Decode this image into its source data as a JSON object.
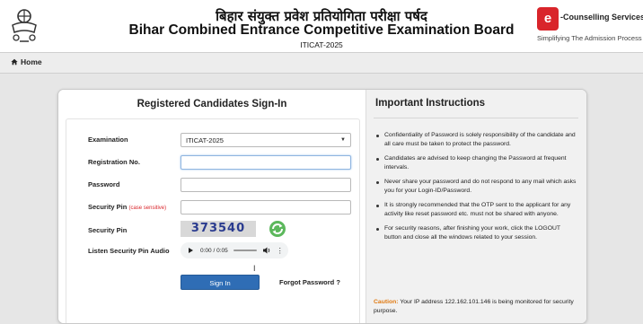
{
  "header": {
    "title_hindi": "बिहार संयुक्त प्रवेश प्रतियोगिता परीक्षा पर्षद",
    "title_english": "Bihar Combined Entrance Competitive Examination Board",
    "exam_code": "ITICAT-2025",
    "logo": {
      "badge": "e",
      "name": "-Counselling Services",
      "tagline": "Simplifying The Admission Process"
    }
  },
  "nav": {
    "home": "Home"
  },
  "signin": {
    "title": "Registered Candidates Sign-In",
    "examination_label": "Examination",
    "examination_value": "ITICAT-2025",
    "registration_label": "Registration No.",
    "registration_value": "",
    "password_label": "Password",
    "password_value": "",
    "security_pin_label": "Security Pin",
    "security_pin_note": "(case sensitive)",
    "security_pin_value": "",
    "captcha_label": "Security Pin",
    "captcha_text": "373540",
    "audio_label": "Listen Security Pin Audio",
    "audio_time": "0:00 / 0:05",
    "signin_button": "Sign In",
    "forgot_password": "Forgot Password ?"
  },
  "instructions": {
    "title": "Important Instructions",
    "items": [
      "Confidentiality of Password is solely responsibility of the candidate and all care must be taken to protect the password.",
      "Candidates are advised to keep changing the Password at frequent intervals.",
      "Never share your password and do not respond to any mail which asks you for your Login-ID/Password.",
      "It is strongly recommended that the OTP sent to the applicant for any activity like reset password etc. must not be shared with anyone.",
      "For security reasons, after finishing your work, click the LOGOUT button and close all the windows related to your session."
    ],
    "caution_label": "Caution:",
    "caution_text": "Your IP address 122.162.101.146 is being monitored for security purpose."
  },
  "colors": {
    "accent": "#2f6db5",
    "brand_red": "#d9252b",
    "caution": "#e07a12"
  },
  "icons": {
    "emblem": "bihar-emblem-icon",
    "home": "home-icon",
    "refresh": "refresh-icon",
    "play": "play-icon",
    "volume": "volume-icon",
    "menu": "kebab-icon"
  }
}
